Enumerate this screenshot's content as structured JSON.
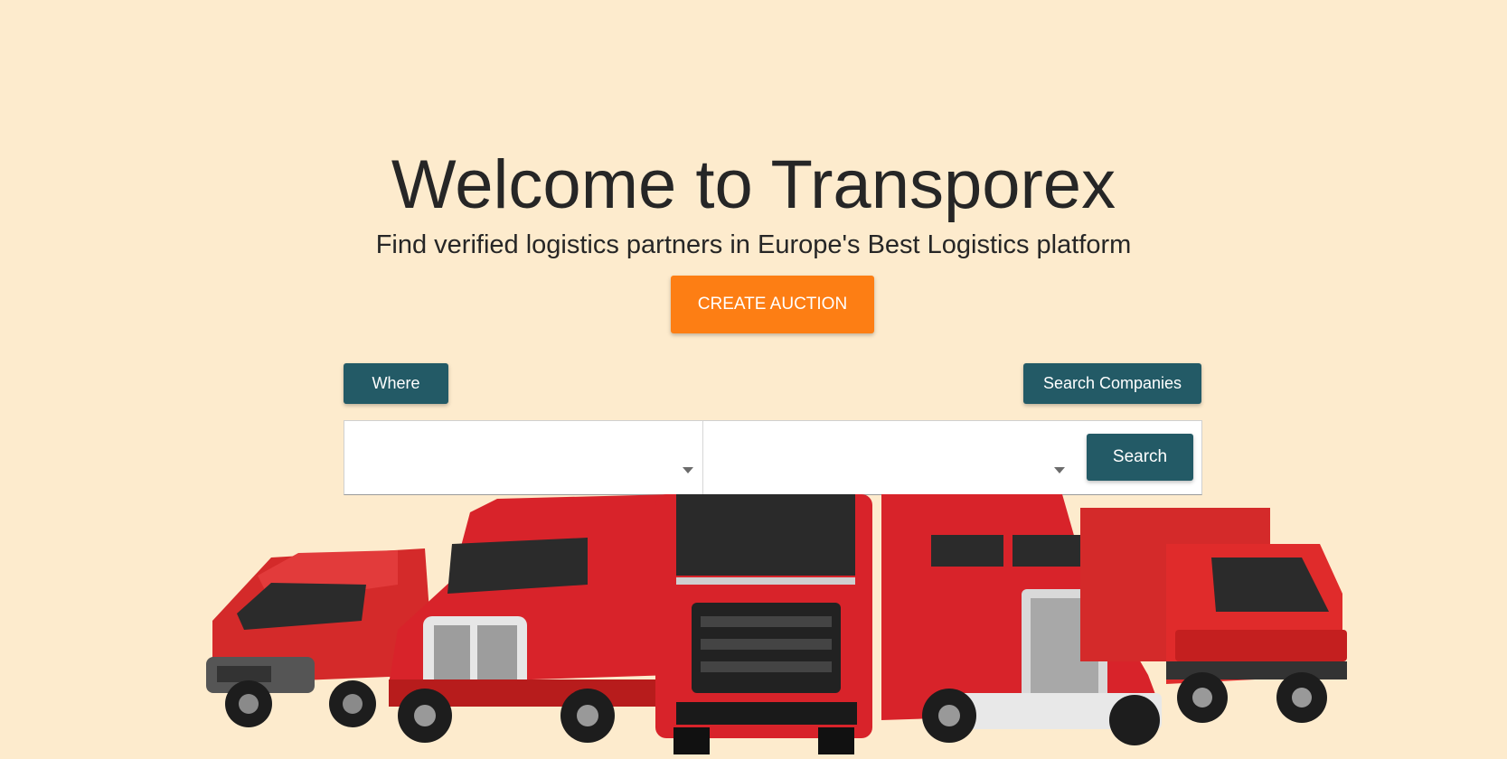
{
  "hero": {
    "title": "Welcome to Transporex",
    "subtitle": "Find verified logistics partners in Europe's Best Logistics platform",
    "cta_label": "CREATE AUCTION"
  },
  "filters": {
    "where_label": "Where",
    "companies_label": "Search Companies"
  },
  "search": {
    "from_value": "",
    "to_value": "",
    "button_label": "Search"
  },
  "colors": {
    "background": "#fdebcd",
    "accent": "#fd7e14",
    "primary": "#235a66",
    "truck_red": "#d8232a"
  },
  "image": {
    "description_icon": "truck-fleet-image"
  }
}
